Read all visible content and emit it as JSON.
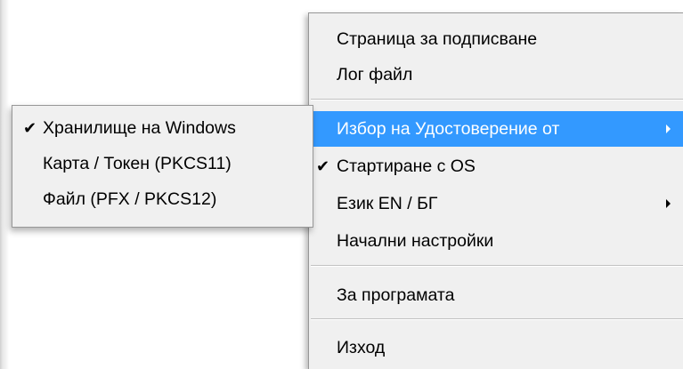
{
  "context_menu": {
    "items": [
      {
        "label": "Страница за подписване",
        "checked": false,
        "submenu": false
      },
      {
        "label": "Лог файл",
        "checked": false,
        "submenu": false
      },
      {
        "label": "Избор на Удостоверение от",
        "checked": false,
        "submenu": true,
        "highlighted": true
      },
      {
        "label": "Стартиране с OS",
        "checked": true,
        "submenu": false
      },
      {
        "label": "Език EN / БГ",
        "checked": false,
        "submenu": true
      },
      {
        "label": "Начални настройки",
        "checked": false,
        "submenu": false
      },
      {
        "label": "За програмата",
        "checked": false,
        "submenu": false
      },
      {
        "label": "Изход",
        "checked": false,
        "submenu": false
      }
    ],
    "check_glyph": "✔",
    "highlight_color": "#3399ff"
  },
  "submenu": {
    "items": [
      {
        "label": "Хранилище на Windows",
        "checked": true
      },
      {
        "label": "Карта / Токен (PKCS11)",
        "checked": false
      },
      {
        "label": "Файл (PFX / PKCS12)",
        "checked": false
      }
    ],
    "check_glyph": "✔"
  }
}
